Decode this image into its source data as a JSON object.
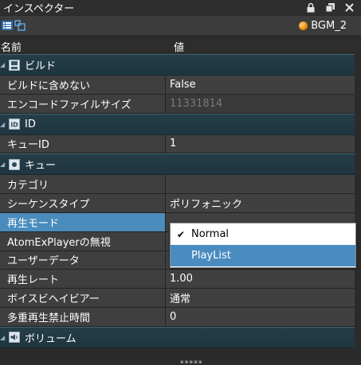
{
  "window": {
    "title": "インスペクター"
  },
  "toolbar": {
    "selected_object": "BGM_2"
  },
  "header": {
    "name_col": "名前",
    "value_col": "値"
  },
  "groups": {
    "build": {
      "label": "ビルド"
    },
    "id": {
      "label": "ID"
    },
    "cue": {
      "label": "キュー"
    },
    "volume": {
      "label": "ボリューム"
    }
  },
  "rows": {
    "exclude_from_build": {
      "name": "ビルドに含めない",
      "value": "False"
    },
    "encode_file_size": {
      "name": "エンコードファイルサイズ",
      "value": "11331814"
    },
    "cue_id": {
      "name": "キューID",
      "value": "1"
    },
    "category": {
      "name": "カテゴリ",
      "value": ""
    },
    "sequence_type": {
      "name": "シーケンスタイプ",
      "value": "ポリフォニック"
    },
    "play_mode": {
      "name": "再生モード",
      "value": ""
    },
    "ignore_atomexplayer": {
      "name": "AtomExPlayerの無視",
      "value": ""
    },
    "user_data": {
      "name": "ユーザーデータ",
      "value": ""
    },
    "play_rate": {
      "name": "再生レート",
      "value": "1.00"
    },
    "voice_behavior": {
      "name": "ボイスビヘイビアー",
      "value": "通常"
    },
    "multi_play_block_time": {
      "name": "多重再生禁止時間",
      "value": "0"
    }
  },
  "dropdown": {
    "options": [
      {
        "label": "Normal",
        "checked": true
      },
      {
        "label": "PlayList",
        "checked": false
      }
    ]
  }
}
